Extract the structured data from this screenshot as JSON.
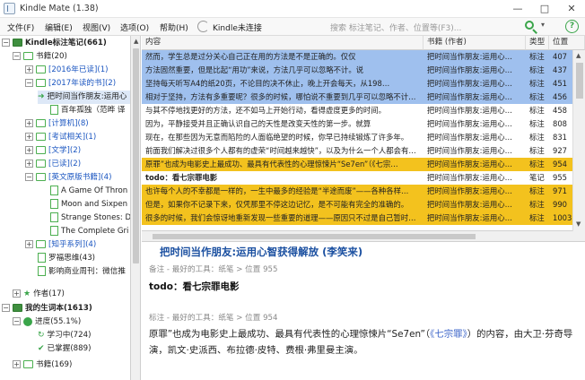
{
  "window": {
    "title": "Kindle Mate (1.38)",
    "minimize": "—",
    "maximize": "□",
    "close": "✕"
  },
  "menu": {
    "items": [
      "文件(F)",
      "编辑(E)",
      "视图(V)",
      "选项(O)",
      "帮助(H)"
    ],
    "sync_label": "Kindle未连接",
    "search_placeholder": "搜索 标注笔记、作者、位置等(F3)...",
    "search_caret": "▾",
    "help": "?"
  },
  "sidebar": {
    "rows": [
      {
        "label": "Kindle标注笔记(661)"
      },
      {
        "label": "书籍(20)"
      },
      {
        "label": "[2016年已读](1)"
      },
      {
        "label": "[2017年读的书](2)"
      },
      {
        "label": "把时间当作朋友:运用心"
      },
      {
        "label": "百年孤独（范晔 译"
      },
      {
        "label": "[计算机](8)"
      },
      {
        "label": "[考试相关](1)"
      },
      {
        "label": "[文学](2)"
      },
      {
        "label": "[已读](2)"
      },
      {
        "label": "[英文原版书籍](4)"
      },
      {
        "label": "A Game Of Thron"
      },
      {
        "label": "Moon and Sixpen"
      },
      {
        "label": "Strange Stones: D"
      },
      {
        "label": "The Complete Gri"
      },
      {
        "label": "[知乎系列](4)"
      },
      {
        "label": "罗福思维(43)"
      },
      {
        "label": "影响商业周刊：微信推"
      },
      {
        "label": "作者(17)"
      },
      {
        "label": "我的生词本(1613)"
      },
      {
        "label": "进度(55.1%)"
      },
      {
        "label": "学习中(724)"
      },
      {
        "label": "已掌握(889)"
      },
      {
        "label": "书籍(169)"
      }
    ]
  },
  "table": {
    "headers": {
      "content": "内容",
      "book": "书籍 (作者)",
      "type": "类型",
      "pos": "位置"
    },
    "rows": [
      {
        "content": "然而，学生总是过分关心自己正在用的方法是不是正确的。仅仅",
        "book": "把时间当作朋友:运用心…",
        "type": "标注",
        "pos": "407",
        "style": "blue"
      },
      {
        "content": "方法固然重要，但是比起“用功”来说，方法几乎可以忽略不计。说",
        "book": "把时间当作朋友:运用心…",
        "type": "标注",
        "pos": "437",
        "style": "blue"
      },
      {
        "content": "坚持每天听写A4的纸20页，不论目的决不休止，晚上开会每天，从198…",
        "book": "把时间当作朋友:运用心…",
        "type": "标注",
        "pos": "451",
        "style": "blue"
      },
      {
        "content": "相对于坚持，方法有多重要呢？很多的时候，哪怕说不重要到几乎可以忽略不计…",
        "book": "把时间当作朋友:运用心…",
        "type": "标注",
        "pos": "456",
        "style": "blue"
      },
      {
        "content": "与其不停地找更好的方法，还不如马上开始行动，看得虚度更多的时间。",
        "book": "把时间当作朋友:运用心…",
        "type": "标注",
        "pos": "458",
        "style": "white"
      },
      {
        "content": "因为，平静接受并且正确认识自己的天性是改变天性的第一步。就算",
        "book": "把时间当作朋友:运用心…",
        "type": "标注",
        "pos": "808",
        "style": "white"
      },
      {
        "content": "现在，在那些因为无意而陷险的人面临绝望的时候，你早已持续锻炼了许多年。",
        "book": "把时间当作朋友:运用心…",
        "type": "标注",
        "pos": "831",
        "style": "white"
      },
      {
        "content": "前面我们解决过很多个人都有的虚荣“时间越来越快”，以及为什么一个人都会有…",
        "book": "把时间当作朋友:运用心…",
        "type": "标注",
        "pos": "927",
        "style": "white"
      },
      {
        "content": "原罪”也成为电影史上最成功、最具有代表性的心理惊悚片“Se7en”（《七宗…",
        "book": "把时间当作朋友:运用心…",
        "type": "标注",
        "pos": "954",
        "style": "yellow"
      },
      {
        "content": "todo：看七宗罪电影",
        "book": "把时间当作朋友:运用心…",
        "type": "笔记",
        "pos": "955",
        "style": "white-bold"
      },
      {
        "content": "也许每个人的不幸都是一样的，一生中最多的经验是“半途而废”——各种各样…",
        "book": "把时间当作朋友:运用心…",
        "type": "标注",
        "pos": "971",
        "style": "yellow"
      },
      {
        "content": "但是，如果你不记录下来，仅凭那里不停这边记忆，是不可能有完全的准确的。",
        "book": "把时间当作朋友:运用心…",
        "type": "标注",
        "pos": "990",
        "style": "yellow"
      },
      {
        "content": "很多的时候，我们会惊讶地重新发现一些重要的道理——原因只不过是自己暂时…",
        "book": "把时间当作朋友:运用心…",
        "type": "标注",
        "pos": "1003",
        "style": "yellow"
      }
    ]
  },
  "detail": {
    "book": "把时间当作朋友:运用心智获得解放 (李笑来)",
    "meta_note": "备注 - 最好的工具：纸笔 > 位置 955",
    "note": "todo：看七宗罪电影",
    "meta_highlight": "标注 - 最好的工具：纸笔 > 位置 954",
    "text_before": "原罪”也成为电影史上最成功、最具有代表性的心理惊悚片“Se7en”（",
    "text_link": "《七宗罪》",
    "text_after": "）的内容，由大卫·芬奇导演，凯文·史派西、布拉德·皮特、费根·弗里曼主演。"
  }
}
